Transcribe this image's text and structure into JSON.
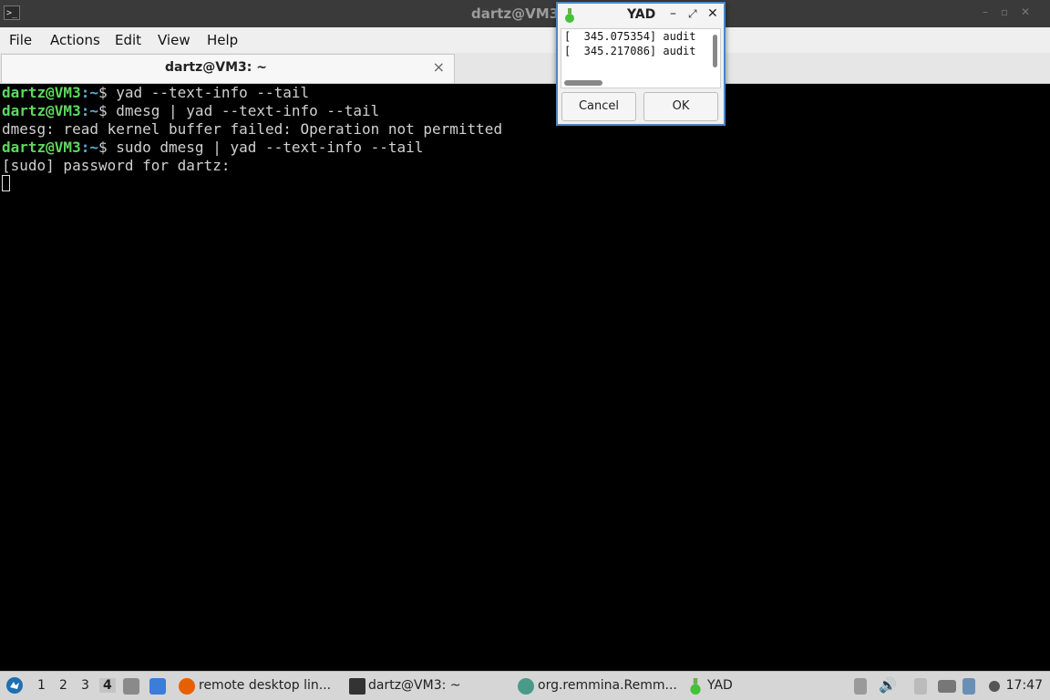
{
  "terminal_window": {
    "title": "dartz@VM3: ~",
    "title_visible": "dartz@VM3",
    "menu": [
      "File",
      "Actions",
      "Edit",
      "View",
      "Help"
    ],
    "tab_label": "dartz@VM3: ~",
    "tab_close": "×",
    "lines": [
      {
        "user": "dartz@VM3",
        "path": ":~",
        "cmd": "$ yad --text-info --tail"
      },
      {
        "user": "dartz@VM3",
        "path": ":~",
        "cmd": "$ dmesg | yad --text-info --tail"
      },
      {
        "text": "dmesg: read kernel buffer failed: Operation not permitted"
      },
      {
        "user": "dartz@VM3",
        "path": ":~",
        "cmd": "$ sudo dmesg | yad --text-info --tail"
      },
      {
        "text": "[sudo] password for dartz:"
      }
    ]
  },
  "yad_dialog": {
    "title": "YAD",
    "minimize": "–",
    "maximize": "⤢",
    "close": "✕",
    "text_lines": [
      "[  345.075354] audit",
      "[  345.217086] audit"
    ],
    "cancel_label": "Cancel",
    "ok_label": "OK"
  },
  "taskbar": {
    "workspaces": [
      "1",
      "2",
      "3",
      "4"
    ],
    "active_workspace": "4",
    "tasks": [
      {
        "label": "remote desktop lin..."
      },
      {
        "label": "dartz@VM3: ~"
      },
      {
        "label": "org.remmina.Remm..."
      },
      {
        "label": "YAD"
      }
    ],
    "clock": "17:47"
  },
  "colors": {
    "prompt_user": "#5fd75f",
    "prompt_path": "#5fafd7",
    "terminal_bg": "#000000",
    "dialog_border": "#4a86c8"
  }
}
